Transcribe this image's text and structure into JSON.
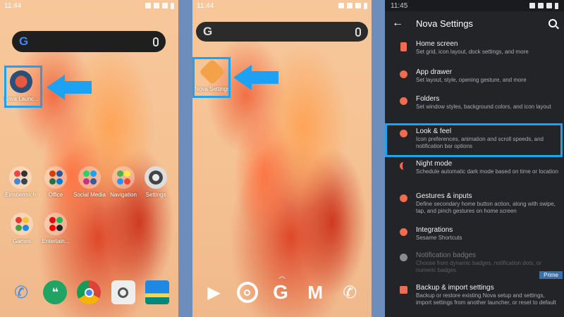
{
  "panel1": {
    "time": "11:44",
    "nova_launcher_label": "Nova Launc...",
    "folders": [
      {
        "label": "Einstiermich"
      },
      {
        "label": "Office"
      },
      {
        "label": "Social Media"
      },
      {
        "label": "Navigation"
      },
      {
        "label": "Settings"
      },
      {
        "label": "Games"
      },
      {
        "label": "Entertain..."
      }
    ],
    "dock": [
      "phone-icon",
      "hangouts-icon",
      "chrome-icon",
      "camera-icon",
      "gallery-icon"
    ]
  },
  "panel2": {
    "time": "11:44",
    "nova_settings_label": "Nova Settings",
    "dock": [
      "play-store-icon",
      "chrome-icon",
      "google-icon",
      "gmail-icon",
      "phone-icon"
    ]
  },
  "panel3": {
    "time": "11:45",
    "title": "Nova Settings",
    "items": [
      {
        "title": "Home screen",
        "desc": "Set grid, icon layout, dock settings, and more"
      },
      {
        "title": "App drawer",
        "desc": "Set layout, style, opening gesture, and more"
      },
      {
        "title": "Folders",
        "desc": "Set window styles, background colors, and icon layout"
      },
      {
        "title": "Look & feel",
        "desc": "Icon preferences, animation and scroll speeds, and notification bar options"
      },
      {
        "title": "Night mode",
        "desc": "Schedule automatic dark mode based on time or location"
      },
      {
        "title": "Gestures & inputs",
        "desc": "Define secondary home button action, along with swipe, tap, and pinch gestures on home screen"
      },
      {
        "title": "Integrations",
        "desc": "Sesame Shortcuts"
      },
      {
        "title": "Notification badges",
        "desc": "Choose from dynamic badges, notification dots, or numeric badges"
      },
      {
        "title": "Backup & import settings",
        "desc": "Backup or restore existing Nova setup and settings, import settings from another launcher, or reset to default"
      }
    ],
    "prime_badge": "Prime"
  },
  "colors": {
    "accent": "#1da1f2",
    "nova_icon": "#f06b4f",
    "settings_bg": "#222428"
  }
}
